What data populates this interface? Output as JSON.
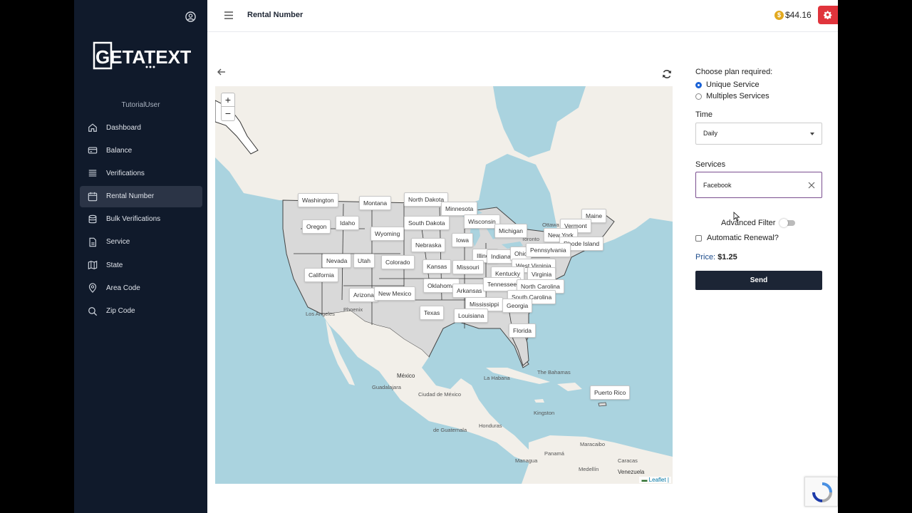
{
  "sidebar": {
    "logo_text": "GETATEXT",
    "username": "TutorialUser",
    "items": [
      {
        "label": "Dashboard",
        "icon": "home-icon"
      },
      {
        "label": "Balance",
        "icon": "wallet-icon"
      },
      {
        "label": "Verifications",
        "icon": "list-icon"
      },
      {
        "label": "Rental Number",
        "icon": "calendar-icon"
      },
      {
        "label": "Bulk Verifications",
        "icon": "database-icon"
      },
      {
        "label": "Service",
        "icon": "document-icon"
      },
      {
        "label": "State",
        "icon": "map-icon"
      },
      {
        "label": "Area Code",
        "icon": "location-pin-icon"
      },
      {
        "label": "Zip Code",
        "icon": "search-icon"
      }
    ]
  },
  "header": {
    "title": "Rental Number",
    "balance": "$44.16",
    "coin_symbol": "$"
  },
  "map": {
    "zoom_in": "+",
    "zoom_out": "−",
    "attribution": "Leaflet |",
    "states": [
      "Washington",
      "Montana",
      "North Dakota",
      "Minnesota",
      "Oregon",
      "Idaho",
      "South Dakota",
      "Wisconsin",
      "Wyoming",
      "Iowa",
      "Michigan",
      "Maine",
      "Vermont",
      "New York",
      "Rhode Island",
      "Nebraska",
      "Illinois",
      "Indiana",
      "Ohio",
      "Pennsylvania",
      "Nevada",
      "Utah",
      "Colorado",
      "Kansas",
      "Missouri",
      "West Virginia",
      "Kentucky",
      "Virginia",
      "California",
      "Arizona",
      "New Mexico",
      "Oklahoma",
      "Arkansas",
      "Tennessee",
      "North Carolina",
      "South Carolina",
      "Mississippi",
      "Georgia",
      "Texas",
      "Louisiana",
      "Florida",
      "Puerto Rico"
    ],
    "places": [
      "Los Angeles",
      "Phoenix",
      "Ottawa",
      "Toronto",
      "México",
      "La Habana",
      "The Bahamas",
      "Guadalajara",
      "Ciudad de México",
      "Kingston",
      "Honduras",
      "de Guatemala",
      "Managua",
      "Caracas",
      "Medellín",
      "Panamá",
      "Venezuela",
      "Maracaibo"
    ]
  },
  "form": {
    "plan_heading": "Choose plan required:",
    "plan_options": [
      "Unique Service",
      "Multiples Services"
    ],
    "plan_selected": 0,
    "time_label": "Time",
    "time_value": "Daily",
    "services_label": "Services",
    "services_value": "Facebook",
    "advanced_filter_label": "Advanced Filter",
    "advanced_filter_on": false,
    "auto_renew_label": "Automatic Renewal?",
    "auto_renew_checked": false,
    "price_label": "Price:",
    "price_value": "$1.25",
    "send_label": "Send"
  },
  "colors": {
    "sidebar_bg": "#101a2b",
    "accent_red": "#e0343c",
    "send_bg": "#1c2535",
    "water": "#aad3df",
    "land": "#f2efe9",
    "us_states": "#d9d9d9"
  }
}
